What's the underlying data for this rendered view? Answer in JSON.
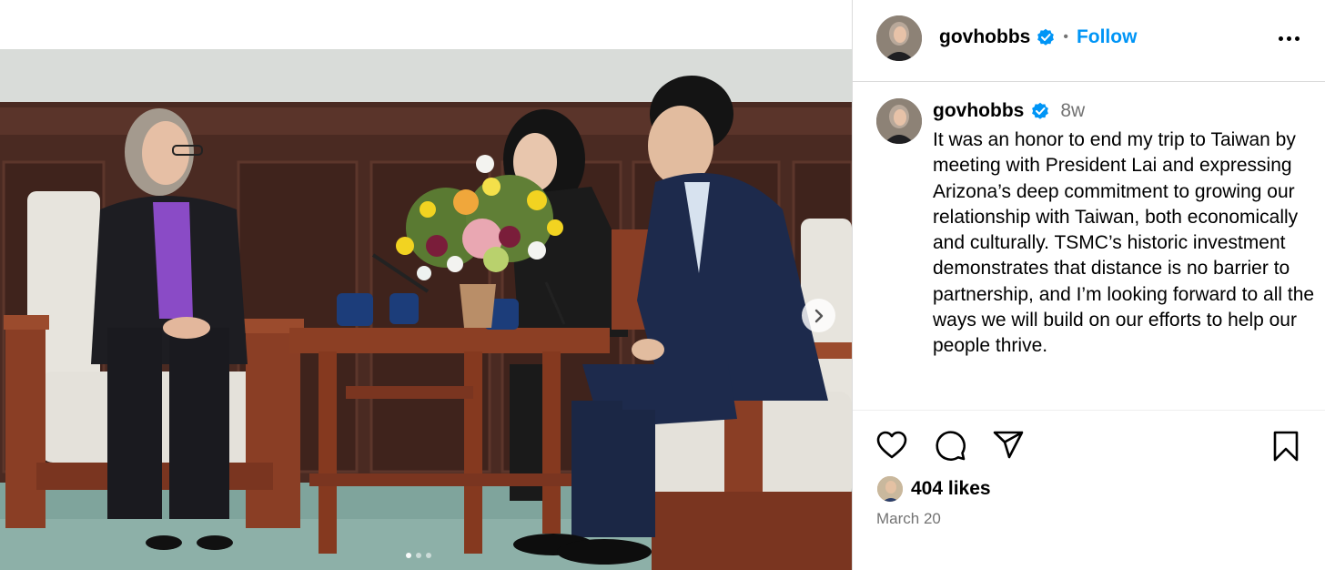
{
  "post": {
    "username": "govhobbs",
    "follow_label": "Follow",
    "separator": "•",
    "age": "8w",
    "caption": "It was an honor to end my trip to Taiwan by meeting with President Lai and expressing Arizona’s deep commitment to growing our relationship with Taiwan, both economically and culturally. TSMC’s historic investment demonstrates that distance is no barrier to partnership, and I’m looking forward to all the ways we will build on our efforts to help our people thrive.",
    "likes": "404 likes",
    "date": "March 20"
  },
  "carousel": {
    "current_slide": 1,
    "total_slides": 3
  },
  "colors": {
    "accent": "#0095f6",
    "muted": "#737373",
    "border": "#dbdbdb"
  },
  "icons": [
    "verified-badge-icon",
    "more-options-icon",
    "heart-icon",
    "comment-icon",
    "share-icon",
    "bookmark-icon",
    "chevron-right-icon"
  ]
}
